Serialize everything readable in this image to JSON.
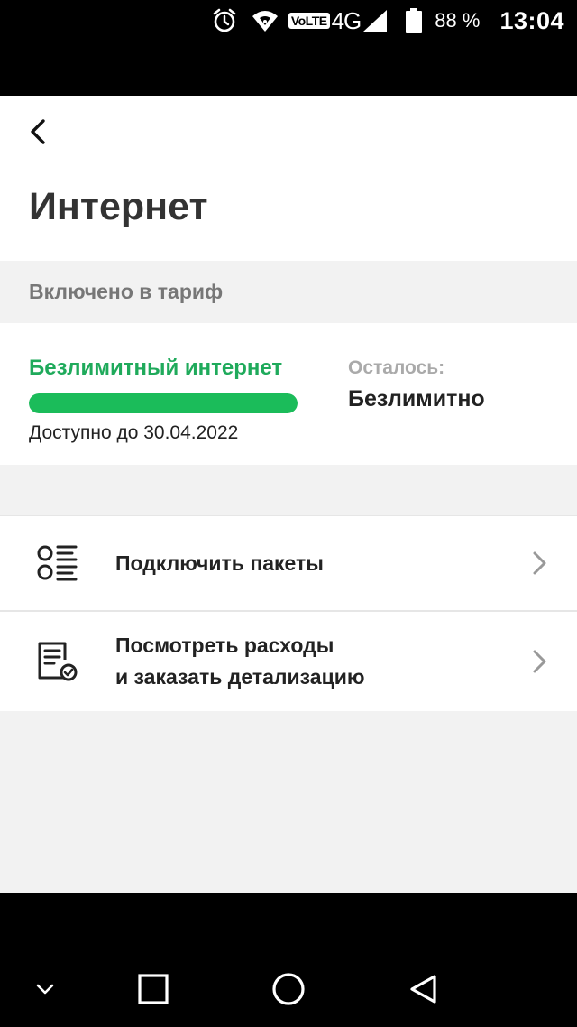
{
  "status_bar": {
    "volte": "VoLTE",
    "network": "4G",
    "battery_percent": "88 %",
    "time": "13:04",
    "icons": [
      "alarm-icon",
      "hotspot-icon",
      "signal-icon",
      "battery-icon"
    ]
  },
  "header": {
    "back_icon": "chevron-left-icon",
    "title": "Интернет"
  },
  "section": {
    "label": "Включено в тариф"
  },
  "tariff": {
    "name": "Безлимитный интернет",
    "progress_fraction": 1.0,
    "available_until": "Доступно до 30.04.2022",
    "remaining_label": "Осталось:",
    "remaining_value": "Безлимитно",
    "colors": {
      "accent": "#1faa5b",
      "bar": "#1bbc5a"
    }
  },
  "menu": {
    "items": [
      {
        "icon": "packages-list-icon",
        "label_lines": [
          "Подключить пакеты"
        ]
      },
      {
        "icon": "expenses-document-icon",
        "label_lines": [
          "Посмотреть расходы",
          "и заказать детализацию"
        ]
      }
    ]
  },
  "nav_bar": {
    "icons": [
      "chevron-down-icon",
      "recents-square-icon",
      "home-circle-icon",
      "back-triangle-icon"
    ]
  }
}
